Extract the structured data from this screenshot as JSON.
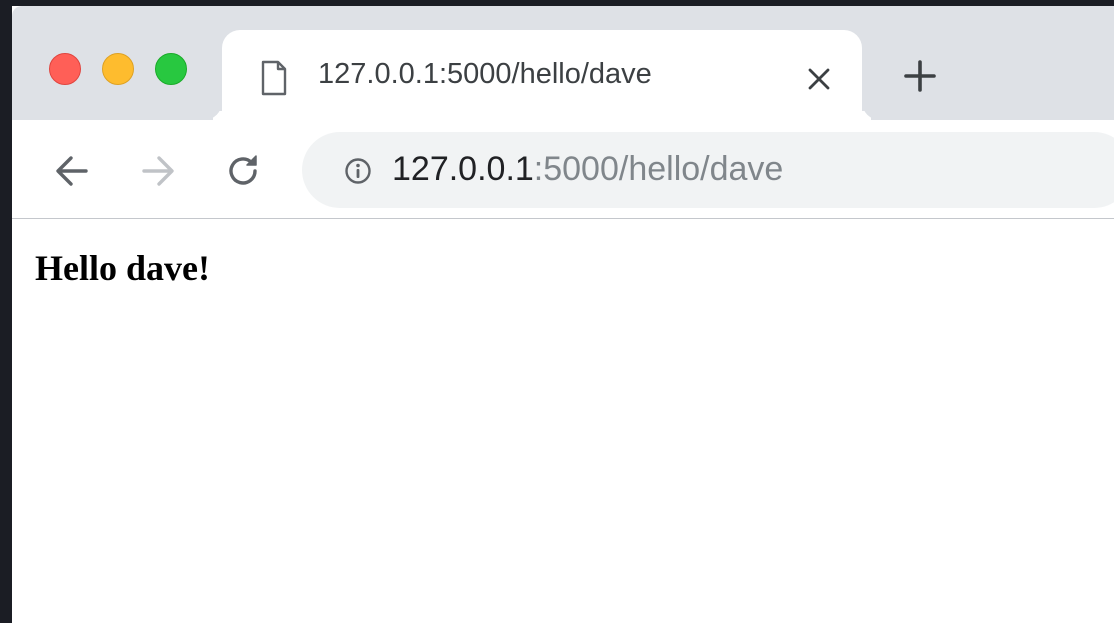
{
  "window": {
    "controls": [
      "close",
      "minimize",
      "maximize"
    ]
  },
  "tab": {
    "title": "127.0.0.1:5000/hello/dave",
    "favicon_icon": "document-icon",
    "close_icon": "close-icon"
  },
  "new_tab": {
    "icon": "plus-icon"
  },
  "toolbar": {
    "back_icon": "arrow-left-icon",
    "forward_icon": "arrow-right-icon",
    "reload_icon": "reload-icon"
  },
  "address_bar": {
    "info_icon": "info-icon",
    "url_host": "127.0.0.1",
    "url_rest": ":5000/hello/dave"
  },
  "page": {
    "heading": "Hello dave!"
  },
  "colors": {
    "tabstrip_bg": "#dee1e6",
    "omnibox_bg": "#f1f3f4",
    "close_button": "#ff5f57",
    "minimize_button": "#febc2e",
    "maximize_button": "#28c840",
    "url_host_color": "#202124",
    "url_rest_color": "#80868b"
  }
}
